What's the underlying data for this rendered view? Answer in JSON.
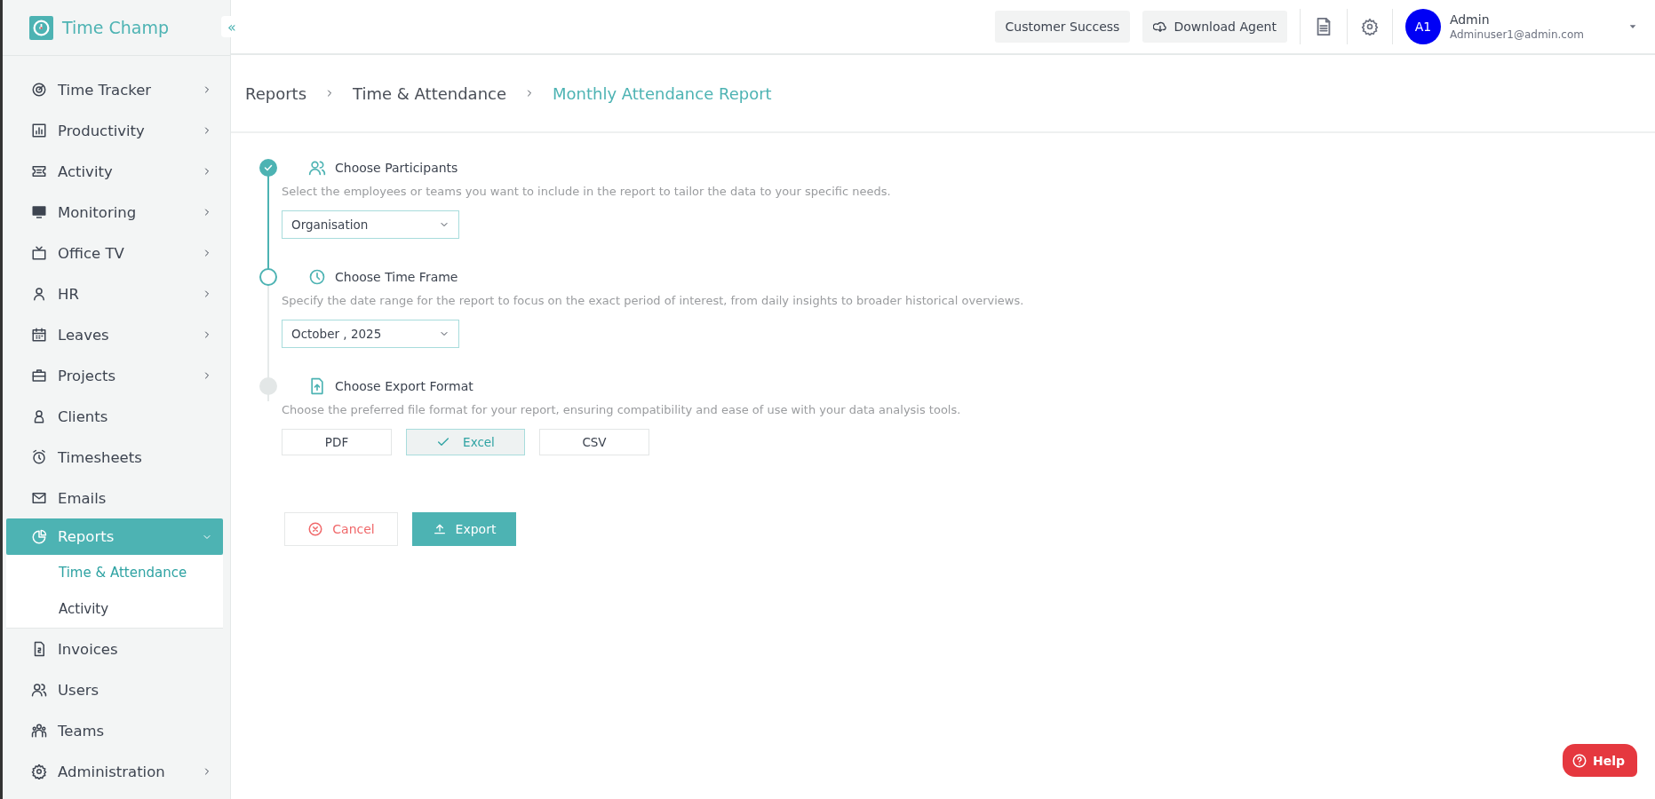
{
  "sidebar": {
    "logo": "Time Champ",
    "collapse_button": "«",
    "items": [
      {
        "label": "Time Tracker",
        "kind": "menu",
        "selected": false,
        "expanded": false
      },
      {
        "label": "Productivity",
        "kind": "menu",
        "selected": false,
        "expanded": false
      },
      {
        "label": "Activity",
        "kind": "menu",
        "selected": false,
        "expanded": false
      },
      {
        "label": "Monitoring",
        "kind": "menu",
        "selected": false,
        "expanded": false
      },
      {
        "label": "Office TV",
        "kind": "menu",
        "selected": false,
        "expanded": false
      },
      {
        "label": "HR",
        "kind": "menu",
        "selected": false,
        "expanded": false
      },
      {
        "label": "Leaves",
        "kind": "menu",
        "selected": false,
        "expanded": false
      },
      {
        "label": "Projects",
        "kind": "menu",
        "selected": false,
        "expanded": false
      },
      {
        "label": "Clients",
        "kind": "link",
        "selected": false
      },
      {
        "label": "Timesheets",
        "kind": "link",
        "selected": false
      },
      {
        "label": "Emails",
        "kind": "link",
        "selected": false
      },
      {
        "label": "Reports",
        "kind": "menu",
        "selected": true,
        "expanded": true,
        "children": [
          {
            "label": "Time & Attendance",
            "selected": true
          },
          {
            "label": "Activity",
            "selected": false
          }
        ]
      },
      {
        "label": "Invoices",
        "kind": "link",
        "selected": false
      },
      {
        "label": "Users",
        "kind": "link",
        "selected": false
      },
      {
        "label": "Teams",
        "kind": "link",
        "selected": false
      },
      {
        "label": "Administration",
        "kind": "menu",
        "selected": false,
        "expanded": false
      }
    ]
  },
  "header": {
    "buttons": [
      {
        "label": "Customer Success",
        "kind": "plain"
      },
      {
        "label": "Download Agent",
        "kind": "download"
      }
    ],
    "user": {
      "initials": "A1",
      "name": "Admin",
      "email": "Adminuser1@admin.com"
    }
  },
  "breadcrumb": [
    {
      "label": "Reports",
      "selected": false
    },
    {
      "label": "Time & Attendance",
      "selected": false
    },
    {
      "label": "Monthly Attendance Report",
      "selected": true
    }
  ],
  "steps": [
    {
      "title": "Choose Participants",
      "description": "Select the employees or teams you want to include in the report to tailor the data to your specific needs.",
      "completed": true,
      "active": false,
      "kind": "dropdown",
      "value": "Organisation"
    },
    {
      "title": "Choose Time Frame",
      "description": "Specify the date range for the report to focus on the exact period of interest, from daily insights to broader historical overviews.",
      "completed": false,
      "active": true,
      "kind": "dropdown",
      "value": "October , 2025"
    },
    {
      "title": "Choose Export Format",
      "description": "Choose the preferred file format for your report, ensuring compatibility and ease of use with your data analysis tools.",
      "completed": false,
      "active": false,
      "kind": "formats",
      "options": [
        {
          "label": "PDF",
          "selected": false
        },
        {
          "label": "Excel",
          "selected": true
        },
        {
          "label": "CSV",
          "selected": false
        }
      ]
    }
  ],
  "actions": {
    "cancel": "Cancel",
    "export": "Export"
  },
  "help": "Help"
}
